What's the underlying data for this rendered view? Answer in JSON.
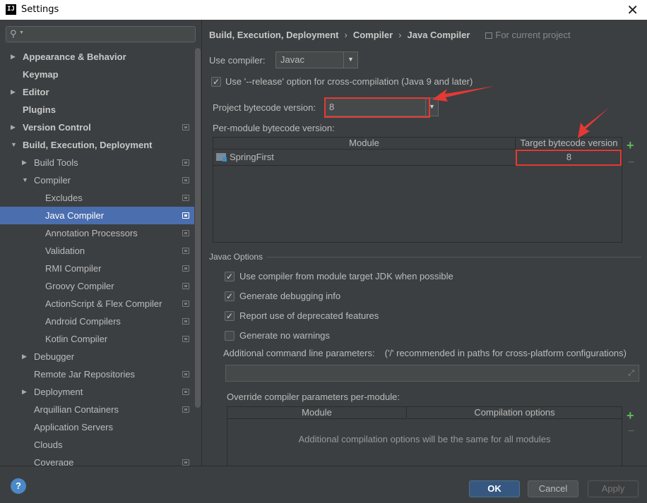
{
  "window": {
    "title": "Settings",
    "app_icon_text": "IJ"
  },
  "search": {
    "placeholder": ""
  },
  "tree": [
    {
      "label": "Appearance & Behavior",
      "level": 0,
      "arrow": "right",
      "bold": true,
      "proj": false
    },
    {
      "label": "Keymap",
      "level": 0,
      "arrow": "",
      "bold": true,
      "proj": false
    },
    {
      "label": "Editor",
      "level": 0,
      "arrow": "right",
      "bold": true,
      "proj": false
    },
    {
      "label": "Plugins",
      "level": 0,
      "arrow": "",
      "bold": true,
      "proj": false
    },
    {
      "label": "Version Control",
      "level": 0,
      "arrow": "right",
      "bold": true,
      "proj": true
    },
    {
      "label": "Build, Execution, Deployment",
      "level": 0,
      "arrow": "down",
      "bold": true,
      "proj": false
    },
    {
      "label": "Build Tools",
      "level": 1,
      "arrow": "right",
      "bold": false,
      "proj": true
    },
    {
      "label": "Compiler",
      "level": 1,
      "arrow": "down",
      "bold": false,
      "proj": true
    },
    {
      "label": "Excludes",
      "level": 2,
      "arrow": "",
      "bold": false,
      "proj": true
    },
    {
      "label": "Java Compiler",
      "level": 2,
      "arrow": "",
      "bold": false,
      "proj": true,
      "selected": true
    },
    {
      "label": "Annotation Processors",
      "level": 2,
      "arrow": "",
      "bold": false,
      "proj": true
    },
    {
      "label": "Validation",
      "level": 2,
      "arrow": "",
      "bold": false,
      "proj": true
    },
    {
      "label": "RMI Compiler",
      "level": 2,
      "arrow": "",
      "bold": false,
      "proj": true
    },
    {
      "label": "Groovy Compiler",
      "level": 2,
      "arrow": "",
      "bold": false,
      "proj": true
    },
    {
      "label": "ActionScript & Flex Compiler",
      "level": 2,
      "arrow": "",
      "bold": false,
      "proj": true
    },
    {
      "label": "Android Compilers",
      "level": 2,
      "arrow": "",
      "bold": false,
      "proj": true
    },
    {
      "label": "Kotlin Compiler",
      "level": 2,
      "arrow": "",
      "bold": false,
      "proj": true
    },
    {
      "label": "Debugger",
      "level": 1,
      "arrow": "right",
      "bold": false,
      "proj": false
    },
    {
      "label": "Remote Jar Repositories",
      "level": 1,
      "arrow": "",
      "bold": false,
      "proj": true
    },
    {
      "label": "Deployment",
      "level": 1,
      "arrow": "right",
      "bold": false,
      "proj": true
    },
    {
      "label": "Arquillian Containers",
      "level": 1,
      "arrow": "",
      "bold": false,
      "proj": true
    },
    {
      "label": "Application Servers",
      "level": 1,
      "arrow": "",
      "bold": false,
      "proj": false
    },
    {
      "label": "Clouds",
      "level": 1,
      "arrow": "",
      "bold": false,
      "proj": false
    },
    {
      "label": "Coverage",
      "level": 1,
      "arrow": "",
      "bold": false,
      "proj": true
    }
  ],
  "breadcrumb": {
    "part1": "Build, Execution, Deployment",
    "part2": "Compiler",
    "part3": "Java Compiler",
    "sep": "›",
    "scope": "For current project"
  },
  "use_compiler": {
    "label": "Use compiler:",
    "value": "Javac"
  },
  "release_option": {
    "label": "Use '--release' option for cross-compilation (Java 9 and later)",
    "checked": true
  },
  "project_bytecode": {
    "label": "Project bytecode version:",
    "value": "8"
  },
  "per_module": {
    "label": "Per-module bytecode version:",
    "columns": [
      "Module",
      "Target bytecode version"
    ],
    "rows": [
      {
        "module": "SpringFirst",
        "version": "8"
      }
    ]
  },
  "javac_options": {
    "title": "Javac Options",
    "checkboxes": [
      {
        "label": "Use compiler from module target JDK when possible",
        "checked": true
      },
      {
        "label": "Generate debugging info",
        "checked": true
      },
      {
        "label": "Report use of deprecated features",
        "checked": true
      },
      {
        "label": "Generate no warnings",
        "checked": false
      }
    ],
    "cmdline_label": "Additional command line parameters:",
    "cmdline_hint": "('/' recommended in paths for cross-platform configurations)",
    "cmdline_value": "",
    "override_label": "Override compiler parameters per-module:",
    "override_columns": [
      "Module",
      "Compilation options"
    ],
    "override_empty": "Additional compilation options will be the same for all modules"
  },
  "buttons": {
    "ok": "OK",
    "cancel": "Cancel",
    "apply": "Apply",
    "help": "?"
  },
  "colors": {
    "accent": "#4b6eaf",
    "highlight": "#e53935",
    "add": "#5fb85f"
  },
  "icons": {
    "plus": "+",
    "minus": "−",
    "check": "✓",
    "dropdown": "▼"
  }
}
